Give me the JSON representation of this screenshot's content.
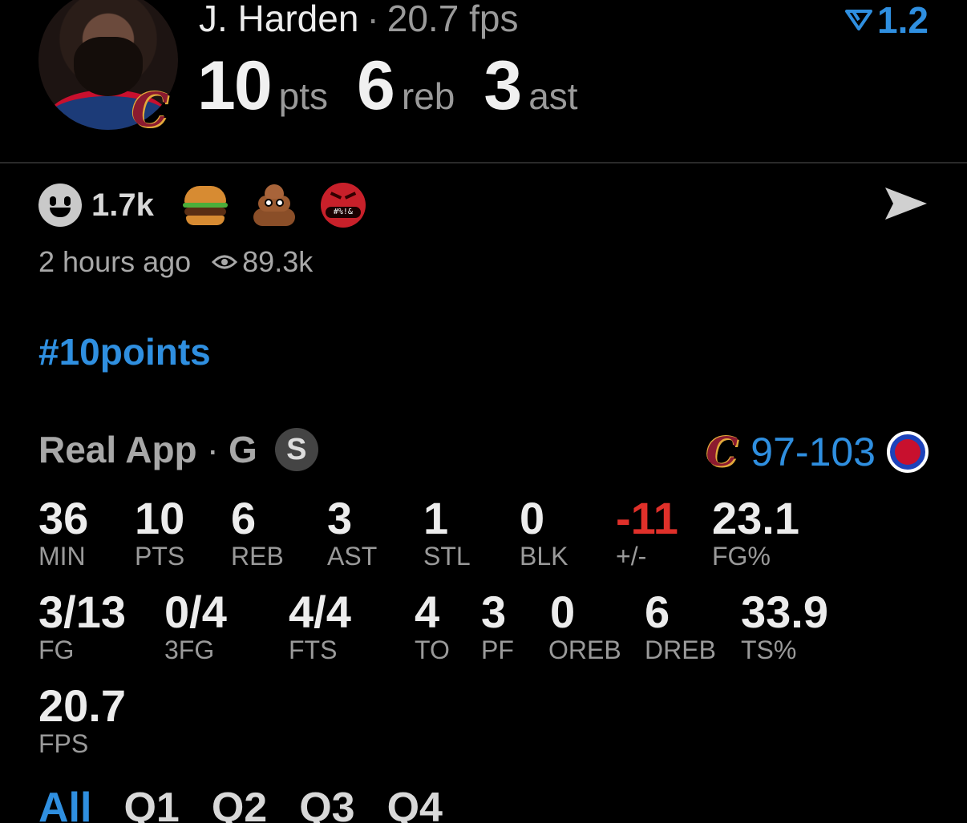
{
  "header": {
    "player_name": "J. Harden",
    "separator": "·",
    "fps_text": "20.7 fps",
    "rating": "1.2",
    "statline": [
      {
        "value": "10",
        "unit": "pts"
      },
      {
        "value": "6",
        "unit": "reb"
      },
      {
        "value": "3",
        "unit": "ast"
      }
    ],
    "team_logo_letter": "C"
  },
  "reactions": {
    "count": "1.7k",
    "items": [
      "smiley-icon",
      "burger-emoji",
      "poo-emoji",
      "angry-cursing-emoji"
    ],
    "curse_text": "#%!&"
  },
  "meta": {
    "time_ago": "2 hours ago",
    "views": "89.3k"
  },
  "hashtag": "#10points",
  "game": {
    "source": "Real App",
    "separator": "·",
    "sport": "G",
    "badge": "S",
    "team_logo_letter": "C",
    "score": "97-103"
  },
  "box_score": [
    {
      "value": "36",
      "label": "MIN"
    },
    {
      "value": "10",
      "label": "PTS"
    },
    {
      "value": "6",
      "label": "REB"
    },
    {
      "value": "3",
      "label": "AST"
    },
    {
      "value": "1",
      "label": "STL"
    },
    {
      "value": "0",
      "label": "BLK"
    },
    {
      "value": "-11",
      "label": "+/-"
    },
    {
      "value": "23.1",
      "label": "FG%"
    },
    {
      "value": "3/13",
      "label": "FG"
    },
    {
      "value": "0/4",
      "label": "3FG"
    },
    {
      "value": "4/4",
      "label": "FTS"
    },
    {
      "value": "4",
      "label": "TO"
    },
    {
      "value": "3",
      "label": "PF"
    },
    {
      "value": "0",
      "label": "OREB"
    },
    {
      "value": "6",
      "label": "DREB"
    },
    {
      "value": "33.9",
      "label": "TS%"
    },
    {
      "value": "20.7",
      "label": "FPS"
    }
  ],
  "quarters": {
    "tabs": [
      "All",
      "Q1",
      "Q2",
      "Q3",
      "Q4"
    ],
    "active": "All"
  },
  "colors": {
    "accent": "#2f8fe0",
    "negative": "#e0302a",
    "background": "#000000"
  }
}
